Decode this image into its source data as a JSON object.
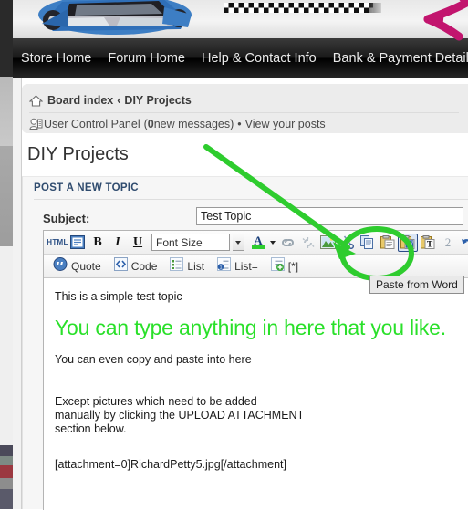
{
  "banner": {
    "car_alt": "blue-race-car",
    "flag_alt": "checkered-flag",
    "magenta_arrow_alt": "magenta-arrow-annotation"
  },
  "nav": {
    "items": [
      {
        "label": "Store Home",
        "name": "nav-store-home"
      },
      {
        "label": "Forum Home",
        "name": "nav-forum-home"
      },
      {
        "label": "Help & Contact Info",
        "name": "nav-help-contact"
      },
      {
        "label": "Bank & Payment Details",
        "name": "nav-bank-payment"
      }
    ]
  },
  "breadcrumb": {
    "home_icon": "home-icon",
    "board_index": "Board index",
    "separator": "‹",
    "current": "DIY Projects",
    "user_icon": "user-control-panel-icon",
    "ucp_label": "User Control Panel",
    "ucp_open": "(",
    "ucp_count": "0",
    "ucp_messages": " new messages)",
    "bullet": "•",
    "view_posts": "View your posts"
  },
  "page": {
    "title": "DIY Projects",
    "panel_heading": "POST A NEW TOPIC",
    "subject_label": "Subject:",
    "subject_value": "Test Topic",
    "subject_placeholder": ""
  },
  "toolbar_row1": [
    {
      "name": "html-button",
      "label": "HTML",
      "type": "text",
      "selected": false
    },
    {
      "name": "wysiwyg-editor-icon",
      "label": "",
      "type": "editor",
      "selected": false
    },
    {
      "name": "bold-button",
      "label": "B",
      "type": "bold",
      "selected": false
    },
    {
      "name": "italic-button",
      "label": "I",
      "type": "italic",
      "selected": false
    },
    {
      "name": "underline-button",
      "label": "U",
      "type": "underline",
      "selected": false
    },
    {
      "name": "font-size-select",
      "label": "Font Size",
      "type": "select",
      "selected": false
    },
    {
      "name": "font-color-picker",
      "label": "A",
      "type": "fontcolor",
      "selected": false
    },
    {
      "name": "insert-link-icon",
      "label": "",
      "type": "link",
      "selected": false
    },
    {
      "name": "unlink-icon",
      "label": "",
      "type": "unlink",
      "selected": false
    },
    {
      "name": "insert-image-icon",
      "label": "",
      "type": "image",
      "selected": false
    },
    {
      "name": "cut-icon",
      "label": "",
      "type": "cut",
      "selected": false
    },
    {
      "name": "copy-icon",
      "label": "",
      "type": "copy",
      "selected": false
    },
    {
      "name": "paste-icon",
      "label": "",
      "type": "paste",
      "selected": false
    },
    {
      "name": "paste-from-word-icon",
      "label": "W",
      "type": "paste-word",
      "selected": true
    },
    {
      "name": "paste-as-text-icon",
      "label": "T",
      "type": "paste-text",
      "selected": false
    },
    {
      "name": "spellcheck-icon",
      "label": "",
      "type": "spell",
      "selected": false
    },
    {
      "name": "undo-icon",
      "label": "",
      "type": "undo",
      "selected": false
    },
    {
      "name": "redo-icon",
      "label": "",
      "type": "redo",
      "selected": false
    }
  ],
  "toolbar_row2": [
    {
      "name": "quote-button",
      "label": "Quote"
    },
    {
      "name": "code-button",
      "label": "Code"
    },
    {
      "name": "list-button",
      "label": "List"
    },
    {
      "name": "ordered-list-button",
      "label": "List="
    },
    {
      "name": "list-item-button",
      "label": "[*]"
    }
  ],
  "tooltip": {
    "text": "Paste from Word"
  },
  "content": {
    "line1": "This is a simple test topic",
    "headline": "You can type anything in here that you like.",
    "line2": "You can even copy and paste into here",
    "para_line1": "Except pictures which need to be added",
    "para_line2": "manually by clicking the UPLOAD ATTACHMENT",
    "para_line3": "section below.",
    "attachment": "[attachment=0]RichardPetty5.jpg[/attachment]"
  },
  "colors": {
    "green_annotation": "#2ecc2e",
    "magenta_annotation": "#c2156e",
    "headline_green": "#2ae02a",
    "nav_background": "#111111",
    "panel_background": "#f6f6f6",
    "breadcrumb_background": "#ececec",
    "selected_border": "#2a4c86"
  }
}
